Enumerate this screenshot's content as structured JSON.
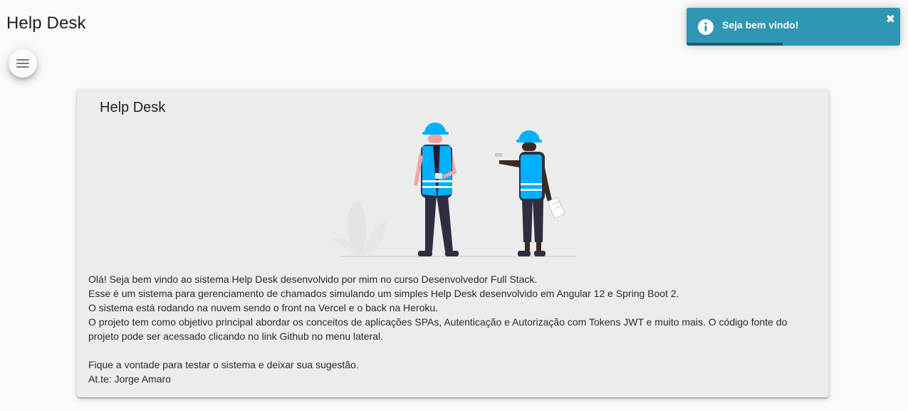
{
  "header": {
    "title": "Help Desk",
    "menu_icon": "menu-icon"
  },
  "card": {
    "title": "Help Desk",
    "illustration": "engineers-illustration",
    "paragraphs": [
      "Olá! Seja bem vindo ao sistema Help Desk desenvolvido por mim no curso Desenvolvedor Full Stack.",
      "Esse é um sistema para gerenciamento de chamados simulando um simples Help Desk desenvolvido em Angular 12 e Spring Boot 2.",
      "O sistema está rodando na nuvem sendo o front na Vercel e o back na Heroku.",
      "O projeto tem como objetivo principal abordar os conceitos de aplicações SPAs, Autenticação e Autorização com Tokens JWT e muito mais. O código fonte do projeto pode ser acessado clicando no link Github no menu lateral."
    ],
    "closing": [
      "Fique a vontade para testar o sistema e deixar sua sugestão.",
      "At.te: Jorge Amaro"
    ]
  },
  "toast": {
    "message": "Seja bem vindo!",
    "icon": "info-icon",
    "close_label": "✖",
    "progress": 0.45,
    "color": "#2f96b4"
  },
  "colors": {
    "background": "#fafafa",
    "card": "#ececec",
    "accent": "#2f96b4",
    "helmet": "#00b0ff"
  }
}
